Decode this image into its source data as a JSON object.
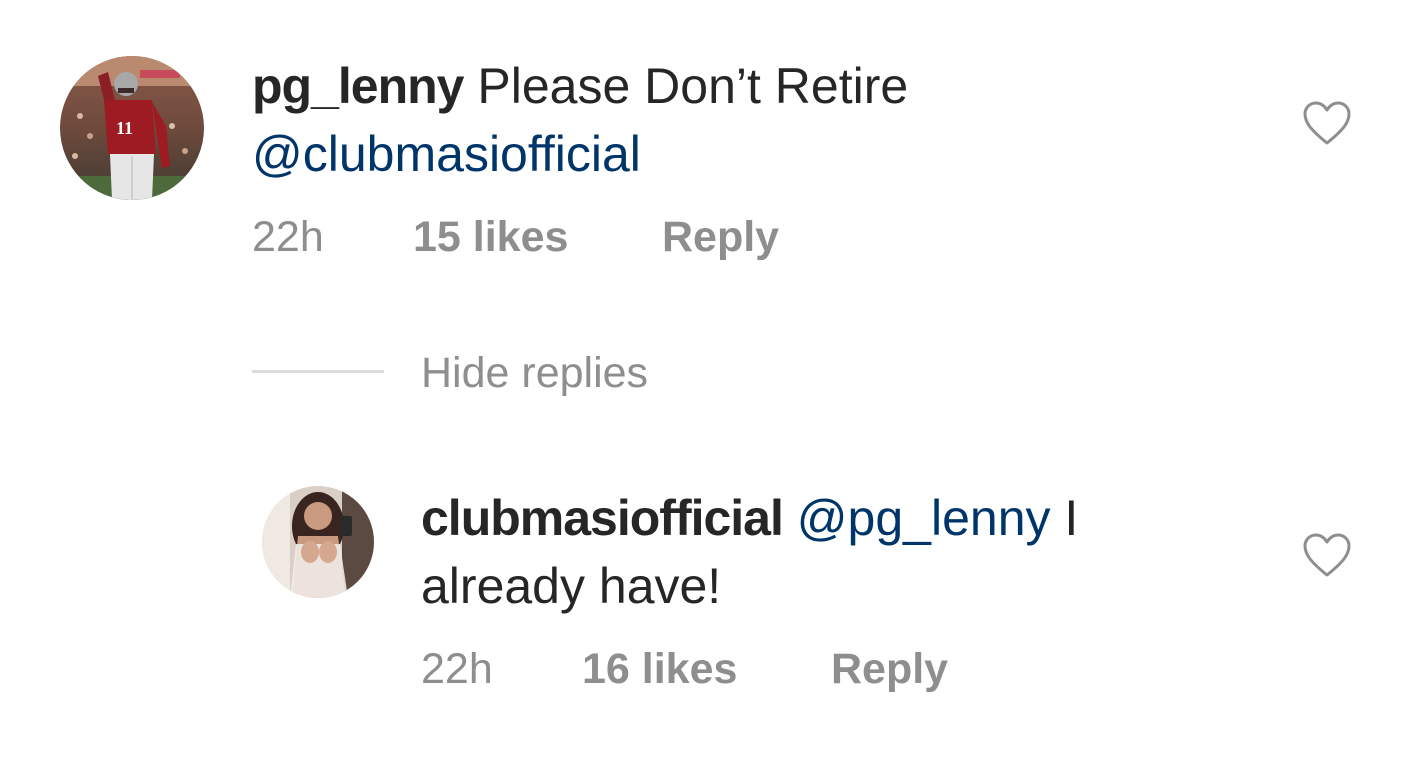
{
  "comment": {
    "username": "pg_lenny",
    "text": "Please Don’t Retire",
    "mention": "@clubmasiofficial",
    "time": "22h",
    "likes": "15 likes",
    "reply_label": "Reply",
    "heart_icon": "heart-outline-icon"
  },
  "hide_replies_label": "Hide replies",
  "reply": {
    "username": "clubmasiofficial",
    "mention": "@pg_lenny",
    "text_part1": "I",
    "text_part2": "already have!",
    "time": "22h",
    "likes": "16 likes",
    "reply_label": "Reply",
    "heart_icon": "heart-outline-icon"
  },
  "colors": {
    "text": "#262626",
    "secondary": "#8e8e8e",
    "mention": "#003569",
    "divider": "#dbdbdb"
  }
}
